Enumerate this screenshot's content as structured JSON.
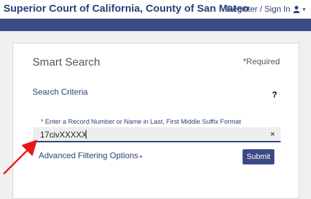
{
  "header": {
    "site_title": "Superior Court of California, County of San Mateo",
    "signin_label": "Register / Sign In",
    "user_icon": "user-icon",
    "caret_glyph": "▾"
  },
  "panel": {
    "title": "Smart Search",
    "required_label": "*Required",
    "criteria_label": "Search Criteria",
    "help_glyph": "?",
    "hint": "* Enter a Record Number or Name in Last, First Middle Suffix Format",
    "search_value": "17civXXXXX",
    "clear_glyph": "×",
    "advanced_label": "Advanced Filtering Options",
    "advanced_caret": "▾",
    "submit_label": "Submit"
  },
  "colors": {
    "brand_navy": "#3b4a85",
    "title_navy": "#2a3f7a",
    "annotation_arrow": "#e8171c"
  }
}
